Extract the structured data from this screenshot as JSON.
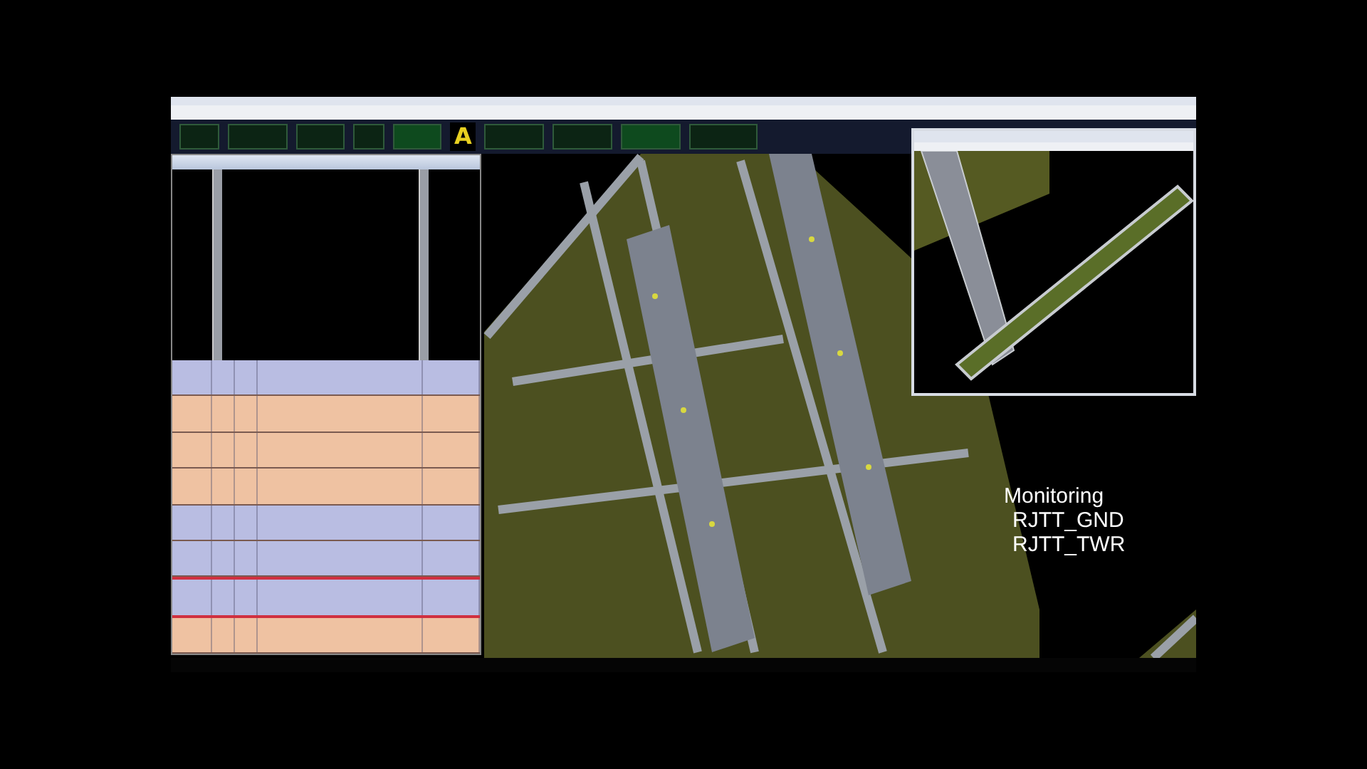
{
  "toolbar": {
    "indicator": "A"
  },
  "strip_window": {
    "strips": [
      {
        "color": "#b9bde2",
        "selected": false
      },
      {
        "color": "#efc2a2",
        "selected": false
      },
      {
        "color": "#efc2a2",
        "selected": false
      },
      {
        "color": "#efc2a2",
        "selected": false
      },
      {
        "color": "#b9bde2",
        "selected": false
      },
      {
        "color": "#b9bde2",
        "selected": false
      },
      {
        "color": "#b9bde2",
        "selected": true
      },
      {
        "color": "#efc2a2",
        "selected": false
      }
    ]
  },
  "overlay": {
    "lines": [
      "Monitoring",
      "RJTT_GND",
      "RJTT_TWR"
    ]
  }
}
